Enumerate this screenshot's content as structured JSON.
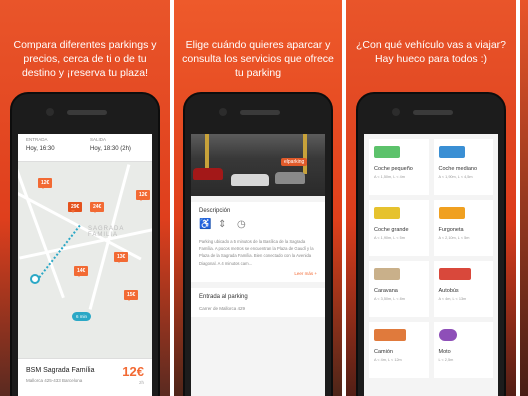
{
  "panels": [
    {
      "caption": "Compara diferentes parkings y precios, cerca de ti o de tu destino y ¡reserva tu plaza!"
    },
    {
      "caption": "Elige cuándo quieres aparcar y consulta los servicios que ofrece tu parking"
    },
    {
      "caption": "¿Con qué vehículo vas a viajar? Hay hueco para todos :)"
    }
  ],
  "search": {
    "entry_label": "ENTRADA",
    "entry_value": "Hoy, 16:30",
    "exit_label": "SALIDA",
    "exit_value": "Hoy, 18:30 (2h)"
  },
  "map": {
    "pins": [
      "12€",
      "29€",
      "24€",
      "12€",
      "14€",
      "13€",
      "15€"
    ],
    "label": "SAGRADA FAMILIA",
    "walk": "6 min"
  },
  "parking_card": {
    "name": "BSM Sagrada Família",
    "address": "Mallorca 425-433 Barcelona",
    "price": "12€",
    "duration": "2h"
  },
  "detail": {
    "description_title": "Descripción",
    "description": "Parking ubicado a 5 minutos de la Basílica de la Sagrada Família. A pocos metros se encuentran la Plaza de Gaudí y la Plaza de la Sagrada Família. Bien conectado con la Avenida Diagonal. A 4 minutos cam...",
    "more": "Leer más +",
    "entry_title": "Entrada al parking",
    "entry_address": "Carrer de Mallorca 429",
    "photo_sign": "elparking"
  },
  "vehicles": [
    {
      "name": "Coche pequeño",
      "size": "A < 1,50m, L < 4m",
      "color": "#5cc26b",
      "icon": "car-icon"
    },
    {
      "name": "Coche mediano",
      "size": "A < 1,90m, L < 4,5m",
      "color": "#3a8fd4",
      "icon": "car-icon"
    },
    {
      "name": "Coche grande",
      "size": "A < 1,90m, L < 5m",
      "color": "#e6c22e",
      "icon": "car-icon"
    },
    {
      "name": "Furgoneta",
      "size": "A < 2,10m, L < 5m",
      "color": "#f0a020",
      "icon": "van-icon"
    },
    {
      "name": "Caravana",
      "size": "A < 3,50m, L < 8m",
      "color": "#c9b08a",
      "icon": "caravan-icon"
    },
    {
      "name": "Autobús",
      "size": "A < 4m, L < 13m",
      "color": "#d9483b",
      "icon": "bus-icon"
    },
    {
      "name": "Camión",
      "size": "A < 4m, L < 12m",
      "color": "#e07a3c",
      "icon": "truck-icon"
    },
    {
      "name": "Moto",
      "size": "L < 2,5m",
      "color": "#8e4fb8",
      "icon": "motorbike-icon"
    }
  ]
}
